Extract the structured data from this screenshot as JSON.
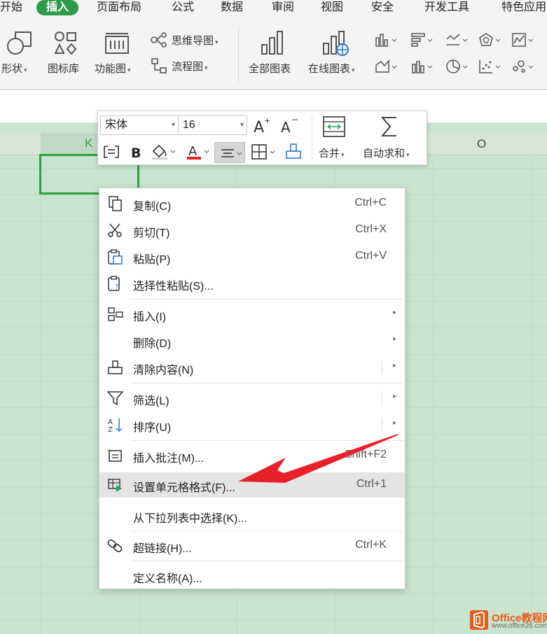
{
  "menu_tabs": [
    "开始",
    "插入",
    "页面布局",
    "公式",
    "数据",
    "审阅",
    "视图",
    "安全",
    "开发工具",
    "特色应用"
  ],
  "active_tab": "插入",
  "ribbon": {
    "shapes": "形状",
    "icon_library": "图标库",
    "function_chart": "功能图",
    "mind_map": "思维导图",
    "flowchart": "流程图",
    "all_charts": "全部图表",
    "online_charts": "在线图表"
  },
  "mini_toolbar": {
    "font_name": "宋体",
    "font_size": "16",
    "merge": "合并",
    "autosum": "自动求和"
  },
  "columns": {
    "k": "K",
    "o": "O"
  },
  "context_menu": [
    {
      "label": "复制(C)",
      "shortcut": "Ctrl+C"
    },
    {
      "label": "剪切(T)",
      "shortcut": "Ctrl+X"
    },
    {
      "label": "粘贴(P)",
      "shortcut": "Ctrl+V"
    },
    {
      "label": "选择性粘贴(S)...",
      "shortcut": ""
    },
    {
      "label": "插入(I)",
      "shortcut": ""
    },
    {
      "label": "删除(D)",
      "shortcut": ""
    },
    {
      "label": "清除内容(N)",
      "shortcut": ""
    },
    {
      "label": "筛选(L)",
      "shortcut": ""
    },
    {
      "label": "排序(U)",
      "shortcut": ""
    },
    {
      "label": "插入批注(M)...",
      "shortcut": "Shift+F2"
    },
    {
      "label": "设置单元格格式(F)...",
      "shortcut": "Ctrl+1"
    },
    {
      "label": "从下拉列表中选择(K)...",
      "shortcut": ""
    },
    {
      "label": "超链接(H)...",
      "shortcut": "Ctrl+K"
    },
    {
      "label": "定义名称(A)...",
      "shortcut": ""
    }
  ],
  "watermark": {
    "brand": "Office教程网",
    "url": "www.office26.com"
  },
  "colors": {
    "active_tab": "#2e9a4c",
    "selection": "#27a23c",
    "arrow": "#e8202a",
    "watermark": "#e85b17"
  }
}
